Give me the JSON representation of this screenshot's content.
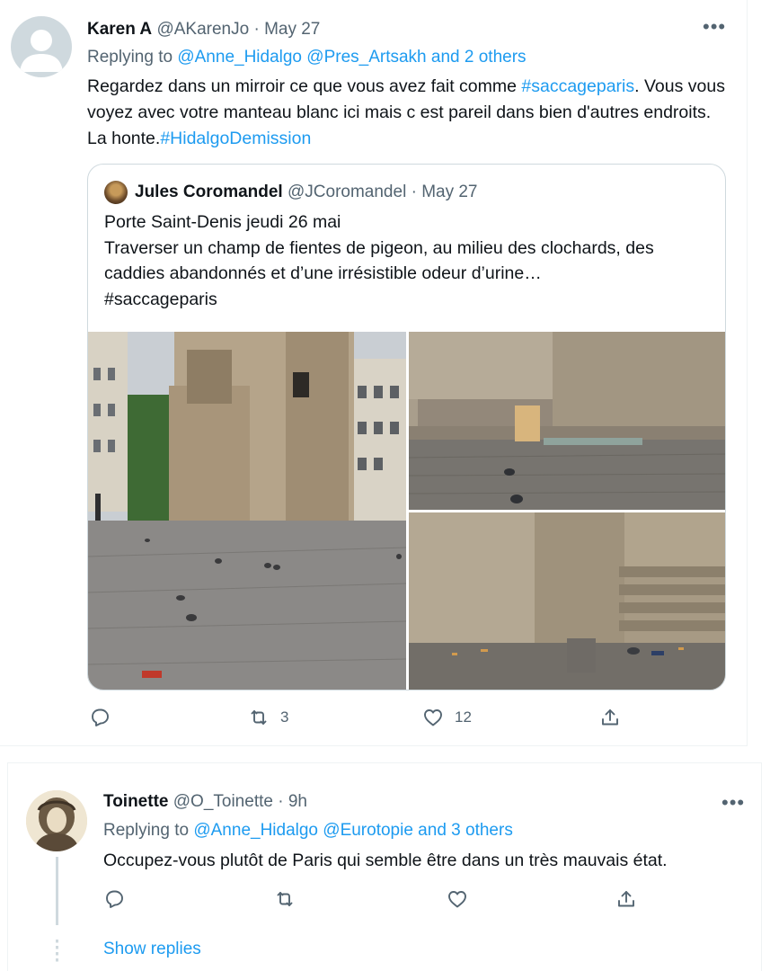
{
  "tweet1": {
    "author_name": "Karen A",
    "handle": "@AKarenJo",
    "separator": "·",
    "date": "May 27",
    "more": "•••",
    "replying_prefix": "Replying to",
    "replying_to": "@Anne_Hidalgo @Pres_Artsakh and 2 others",
    "body_text_1": "Regardez dans un mirroir ce que vous avez fait comme ",
    "body_hashtag_1": "#saccageparis",
    "body_text_2": ". Vous vous voyez avec votre manteau  blanc ici mais c est pareil dans bien d'autres endroits. La honte.",
    "body_hashtag_2": "#HidalgoDemission",
    "quoted": {
      "author_name": "Jules Coromandel",
      "handle": "@JCoromandel",
      "separator": "·",
      "date": "May 27",
      "line1": "Porte Saint-Denis jeudi 26 mai",
      "line2": "Traverser un champ de fientes de pigeon, au milieu des clochards, des caddies abandonnés et d’une irrésistible odeur d’urine…",
      "line3": "#saccageparis"
    },
    "actions": {
      "reply_count": "",
      "retweet_count": "3",
      "like_count": "12"
    }
  },
  "tweet2": {
    "author_name": "Toinette",
    "handle": "@O_Toinette",
    "separator": "·",
    "time": "9h",
    "more": "•••",
    "replying_prefix": "Replying to",
    "replying_to": "@Anne_Hidalgo @Eurotopie and 3 others",
    "body": "Occupez-vous plutôt de Paris qui semble être dans un très mauvais état.",
    "show_replies": "Show replies"
  },
  "colors": {
    "link": "#1d9bf0",
    "muted": "#536471",
    "text": "#0f1419",
    "border": "#cfd9de"
  },
  "icons": [
    "reply-icon",
    "retweet-icon",
    "like-icon",
    "share-icon",
    "more-icon",
    "avatar-placeholder-icon"
  ]
}
